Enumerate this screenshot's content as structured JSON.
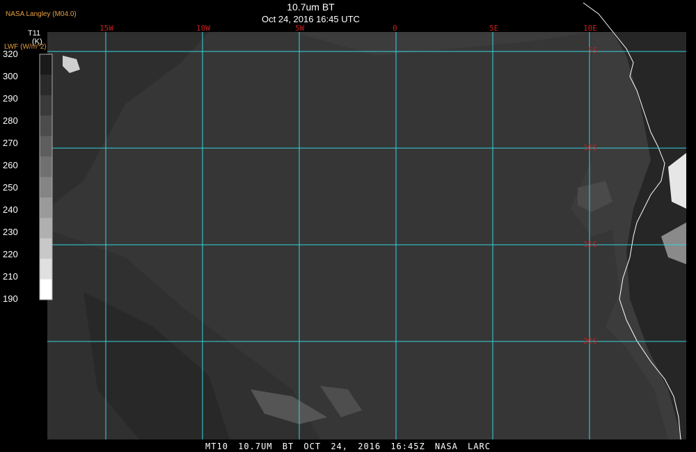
{
  "credit": "NASA Langley (M04.0)",
  "title": "10.7um BT",
  "subtitle": "Oct 24, 2016 16:45 UTC",
  "colorbar": {
    "variable": "T11",
    "unit": "(K)",
    "secondary": "LWF (W/m^2)",
    "ticks": [
      "320",
      "300",
      "290",
      "280",
      "270",
      "260",
      "250",
      "240",
      "230",
      "220",
      "210",
      "190"
    ],
    "colors": [
      "#1a1a1a",
      "#2a2a2a",
      "#3a3a3a",
      "#4c4c4c",
      "#5e5e5e",
      "#707070",
      "#858585",
      "#9a9a9a",
      "#b0b0b0",
      "#c8c8c8",
      "#e0e0e0",
      "#ffffff"
    ]
  },
  "longitude_labels": [
    "15W",
    "10W",
    "5W",
    "0",
    "5E",
    "10E"
  ],
  "latitude_labels": [
    "5S",
    "10S",
    "15S",
    "20S"
  ],
  "footer": "MT10  10.7UM BT  OCT 24, 2016 16:45Z  NASA LARC",
  "colors": {
    "background": "#000000",
    "ocean": "#3c3c3c",
    "grid": "#33d6e0",
    "grid_label": "#c82020",
    "coastline": "#ffffff",
    "accent": "#e8a040"
  }
}
